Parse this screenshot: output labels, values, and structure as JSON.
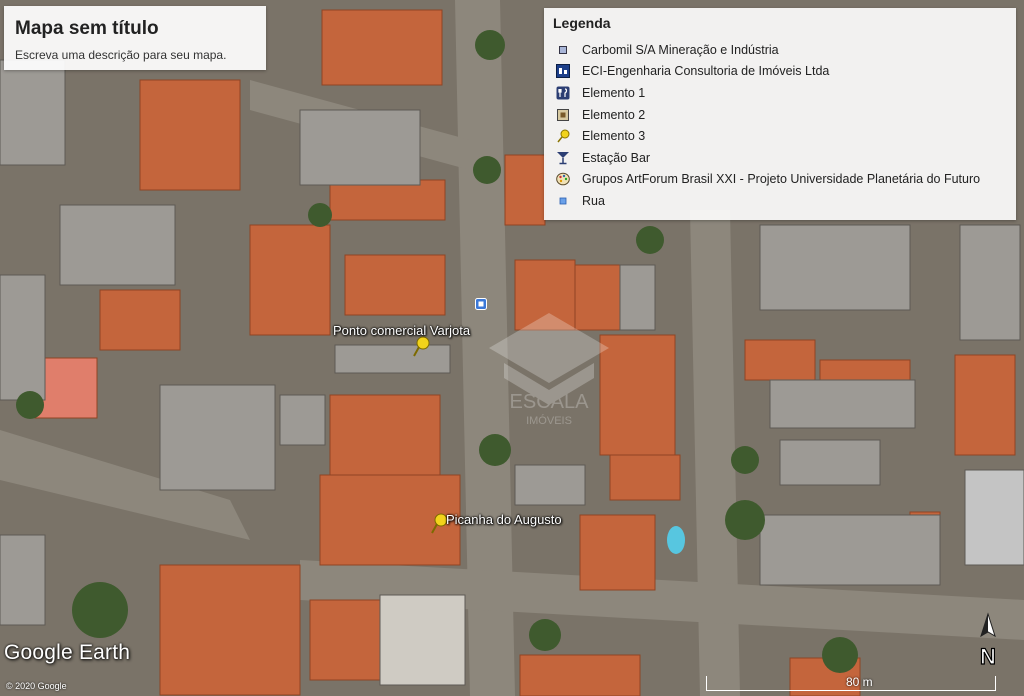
{
  "map": {
    "title": "Mapa sem título",
    "description": "Escreva uma descrição para seu mapa.",
    "legend_title": "Legenda",
    "legend_items": [
      {
        "label": "Carbomil S/A Mineração e Indústria",
        "icon": "small-square-icon"
      },
      {
        "label": "ECI-Engenharia Consultoria de Imóveis Ltda",
        "icon": "building-icon"
      },
      {
        "label": "Elemento 1",
        "icon": "restaurant-icon"
      },
      {
        "label": "Elemento 2",
        "icon": "square-marker-icon"
      },
      {
        "label": "Elemento 3",
        "icon": "yellow-pushpin-icon"
      },
      {
        "label": "Estação Bar",
        "icon": "bar-glass-icon"
      },
      {
        "label": "Grupos ArtForum Brasil XXI - Projeto Universidade Planetária do Futuro",
        "icon": "palette-icon"
      },
      {
        "label": "Rua",
        "icon": "blue-dot-icon"
      }
    ],
    "places": [
      {
        "label": "Ponto comercial Varjota"
      },
      {
        "label": "Picanha do Augusto"
      }
    ],
    "brand": "Google Earth",
    "copyright": "© 2020 Google",
    "scale_label": "80 m",
    "compass_label": "N",
    "watermark_text": "ESCALA",
    "watermark_subtext": "IMÓVEIS",
    "colors": {
      "roof": "#c9643a",
      "street": "#8a8479",
      "tree": "#3f5a2e",
      "pushpin": "#f2d31b"
    }
  }
}
